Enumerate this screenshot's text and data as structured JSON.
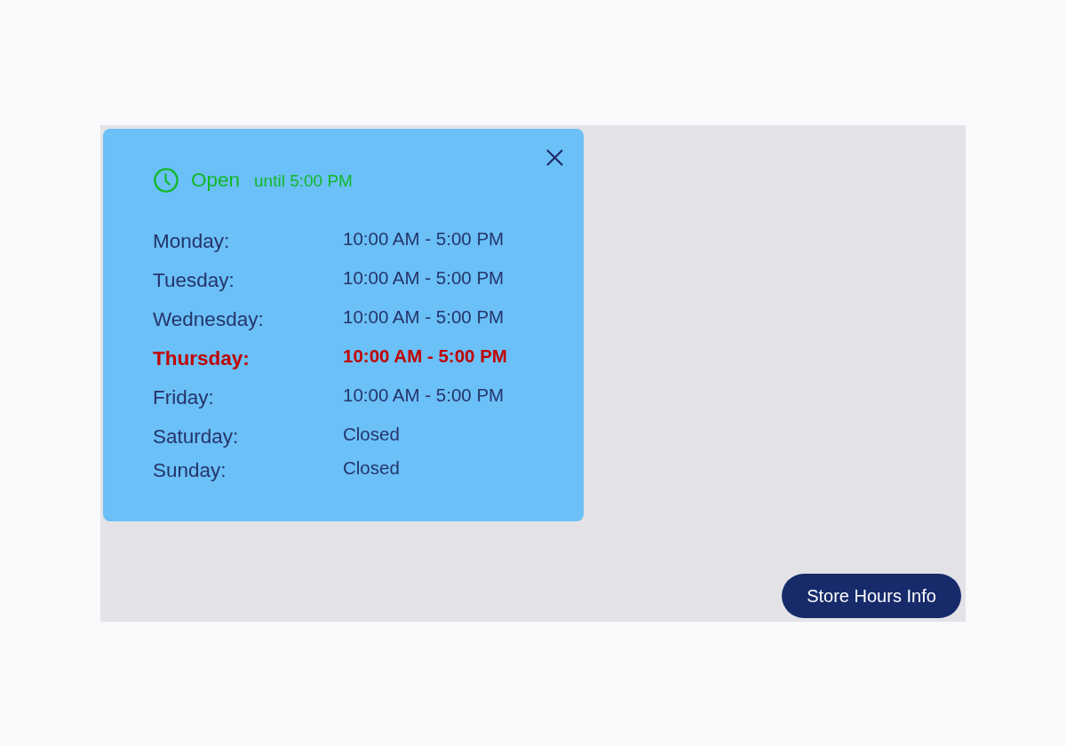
{
  "panel": {
    "status": {
      "open": true,
      "label": "Open",
      "detail": "until 5:00 PM"
    },
    "hours": [
      {
        "day": "Monday:",
        "time": "10:00 AM - 5:00 PM",
        "today": false
      },
      {
        "day": "Tuesday:",
        "time": "10:00 AM - 5:00 PM",
        "today": false
      },
      {
        "day": "Wednesday:",
        "time": "10:00 AM - 5:00 PM",
        "today": false
      },
      {
        "day": "Thursday:",
        "time": "10:00 AM - 5:00 PM",
        "today": true
      },
      {
        "day": "Friday:",
        "time": "10:00 AM - 5:00 PM",
        "today": false
      },
      {
        "day": "Saturday:",
        "time": "Closed",
        "today": false
      },
      {
        "day": "Sunday:",
        "time": "Closed",
        "today": false
      }
    ]
  },
  "button": {
    "label": "Store Hours Info"
  }
}
